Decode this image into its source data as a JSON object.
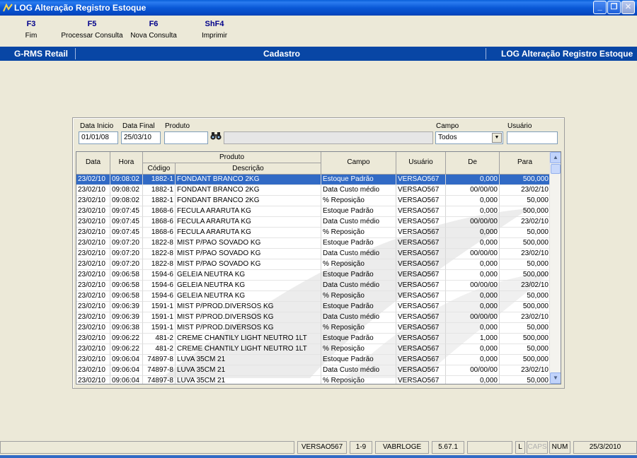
{
  "window": {
    "title": "LOG Alteração Registro Estoque"
  },
  "toolbar": [
    {
      "key": "F3",
      "label": "Fim"
    },
    {
      "key": "F5",
      "label": "Processar Consulta"
    },
    {
      "key": "F6",
      "label": "Nova Consulta"
    },
    {
      "key": "ShF4",
      "label": "Imprimir"
    }
  ],
  "header": {
    "left": "G-RMS Retail",
    "center": "Cadastro",
    "right": "LOG Alteração Registro Estoque"
  },
  "filters": {
    "data_inicio_label": "Data Inicio",
    "data_inicio": "01/01/08",
    "data_final_label": "Data Final",
    "data_final": "25/03/10",
    "produto_label": "Produto",
    "produto": "",
    "produto_desc": "",
    "campo_label": "Campo",
    "campo": "Todos",
    "usuario_label": "Usuário",
    "usuario": ""
  },
  "table": {
    "headers": {
      "data": "Data",
      "hora": "Hora",
      "produto": "Produto",
      "codigo": "Código",
      "descricao": "Descrição",
      "campo": "Campo",
      "usuario": "Usuário",
      "de": "De",
      "para": "Para"
    },
    "rows": [
      [
        "23/02/10",
        "09:08:02",
        "1882-1",
        "FONDANT BRANCO 2KG",
        "Estoque Padrão",
        "VERSAO567",
        "0,000",
        "500,000"
      ],
      [
        "23/02/10",
        "09:08:02",
        "1882-1",
        "FONDANT BRANCO 2KG",
        "Data Custo médio",
        "VERSAO567",
        "00/00/00",
        "23/02/10"
      ],
      [
        "23/02/10",
        "09:08:02",
        "1882-1",
        "FONDANT BRANCO 2KG",
        "% Reposição",
        "VERSAO567",
        "0,000",
        "50,000"
      ],
      [
        "23/02/10",
        "09:07:45",
        "1868-6",
        "FECULA ARARUTA KG",
        "Estoque Padrão",
        "VERSAO567",
        "0,000",
        "500,000"
      ],
      [
        "23/02/10",
        "09:07:45",
        "1868-6",
        "FECULA ARARUTA KG",
        "Data Custo médio",
        "VERSAO567",
        "00/00/00",
        "23/02/10"
      ],
      [
        "23/02/10",
        "09:07:45",
        "1868-6",
        "FECULA ARARUTA KG",
        "% Reposição",
        "VERSAO567",
        "0,000",
        "50,000"
      ],
      [
        "23/02/10",
        "09:07:20",
        "1822-8",
        "MIST P/PAO SOVADO KG",
        "Estoque Padrão",
        "VERSAO567",
        "0,000",
        "500,000"
      ],
      [
        "23/02/10",
        "09:07:20",
        "1822-8",
        "MIST P/PAO SOVADO KG",
        "Data Custo médio",
        "VERSAO567",
        "00/00/00",
        "23/02/10"
      ],
      [
        "23/02/10",
        "09:07:20",
        "1822-8",
        "MIST P/PAO SOVADO KG",
        "% Reposição",
        "VERSAO567",
        "0,000",
        "50,000"
      ],
      [
        "23/02/10",
        "09:06:58",
        "1594-6",
        "GELEIA NEUTRA KG",
        "Estoque Padrão",
        "VERSAO567",
        "0,000",
        "500,000"
      ],
      [
        "23/02/10",
        "09:06:58",
        "1594-6",
        "GELEIA NEUTRA KG",
        "Data Custo médio",
        "VERSAO567",
        "00/00/00",
        "23/02/10"
      ],
      [
        "23/02/10",
        "09:06:58",
        "1594-6",
        "GELEIA NEUTRA KG",
        "% Reposição",
        "VERSAO567",
        "0,000",
        "50,000"
      ],
      [
        "23/02/10",
        "09:06:39",
        "1591-1",
        "MIST P/PROD.DIVERSOS  KG",
        "Estoque Padrão",
        "VERSAO567",
        "0,000",
        "500,000"
      ],
      [
        "23/02/10",
        "09:06:39",
        "1591-1",
        "MIST P/PROD.DIVERSOS  KG",
        "Data Custo médio",
        "VERSAO567",
        "00/00/00",
        "23/02/10"
      ],
      [
        "23/02/10",
        "09:06:38",
        "1591-1",
        "MIST P/PROD.DIVERSOS  KG",
        "% Reposição",
        "VERSAO567",
        "0,000",
        "50,000"
      ],
      [
        "23/02/10",
        "09:06:22",
        "481-2",
        "CREME CHANTILY LIGHT NEUTRO 1LT",
        "Estoque Padrão",
        "VERSAO567",
        "1,000",
        "500,000"
      ],
      [
        "23/02/10",
        "09:06:22",
        "481-2",
        "CREME CHANTILY LIGHT NEUTRO 1LT",
        "% Reposição",
        "VERSAO567",
        "0,000",
        "50,000"
      ],
      [
        "23/02/10",
        "09:06:04",
        "74897-8",
        "LUVA 35CM  21",
        "Estoque Padrão",
        "VERSAO567",
        "0,000",
        "500,000"
      ],
      [
        "23/02/10",
        "09:06:04",
        "74897-8",
        "LUVA 35CM  21",
        "Data Custo médio",
        "VERSAO567",
        "00/00/00",
        "23/02/10"
      ],
      [
        "23/02/10",
        "09:06:04",
        "74897-8",
        "LUVA 35CM  21",
        "% Reposição",
        "VERSAO567",
        "0,000",
        "50,000"
      ]
    ]
  },
  "status": {
    "user": "VERSAO567",
    "page": "1-9",
    "program": "VABRLOGE",
    "version": "5.67.1",
    "l": "L",
    "caps": "CAPS",
    "num": "NUM",
    "date": "25/3/2010"
  },
  "colors": {
    "selection": "#316ac5",
    "header_bar": "#0846a5",
    "title_bar": "#0a58d6"
  }
}
